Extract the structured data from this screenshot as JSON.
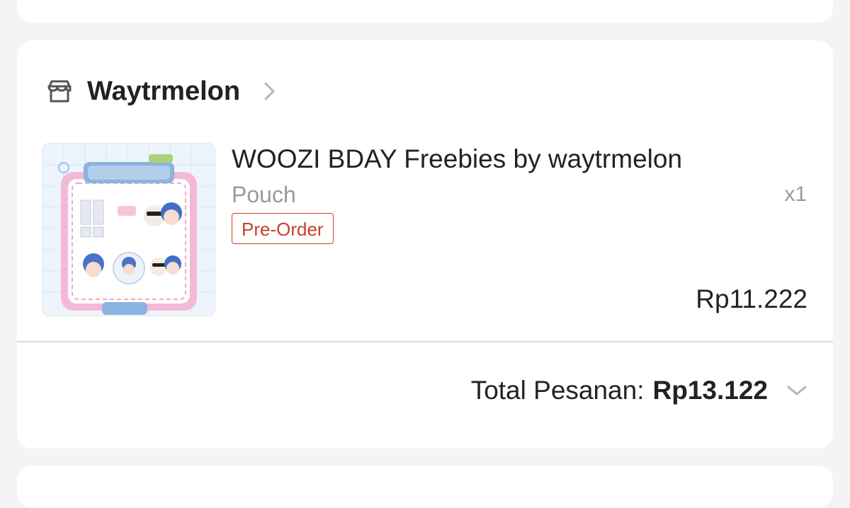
{
  "colors": {
    "background": "#f4f4f4",
    "card": "#ffffff",
    "text_primary": "#222222",
    "text_secondary": "#9a9a9a",
    "badge_accent": "#d0402a"
  },
  "shop": {
    "icon": "store-icon",
    "name": "Waytrmelon",
    "chevron_icon": "chevron-right-icon"
  },
  "product": {
    "thumbnail_icon": "product-thumbnail-image",
    "title": "WOOZI BDAY Freebies by waytrmelon",
    "variant": "Pouch",
    "quantity": "x1",
    "badge": "Pre-Order",
    "price": "Rp11.222"
  },
  "order_total": {
    "label": "Total Pesanan:",
    "value": "Rp13.122",
    "expand_icon": "chevron-down-icon"
  }
}
